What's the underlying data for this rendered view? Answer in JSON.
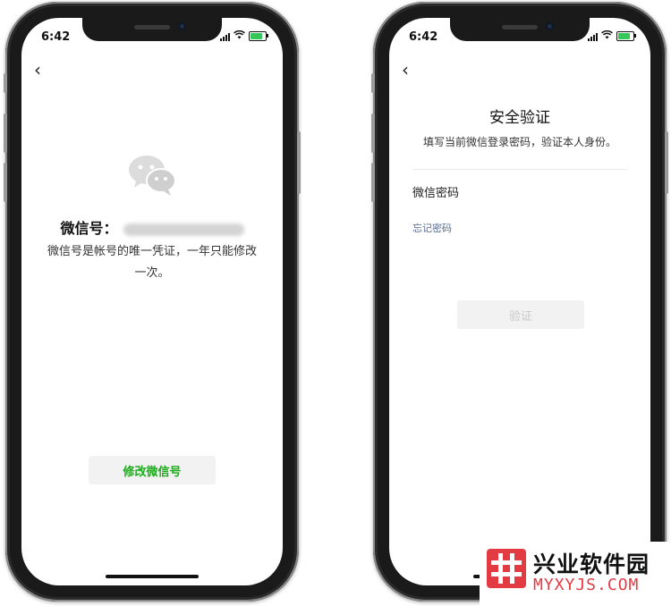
{
  "left_phone": {
    "status_time": "6:42",
    "back_label": "‹",
    "wechat_id_label": "微信号：",
    "description": "微信号是帐号的唯一凭证，一年只能修改一次。",
    "modify_button": "修改微信号"
  },
  "right_phone": {
    "status_time": "6:42",
    "back_label": "‹",
    "title": "安全验证",
    "subtitle": "填写当前微信登录密码，验证本人身份。",
    "password_label": "微信密码",
    "password_value": "",
    "password_placeholder": "",
    "forgot_link": "忘记密码",
    "verify_button": "验证"
  },
  "watermark": {
    "chinese": "兴业软件园",
    "english": "MYXYJS.COM"
  },
  "colors": {
    "wechat_green": "#1aad19",
    "link_blue": "#576b95",
    "disabled_text": "#c8c8c8",
    "watermark_red": "#e23b43"
  }
}
